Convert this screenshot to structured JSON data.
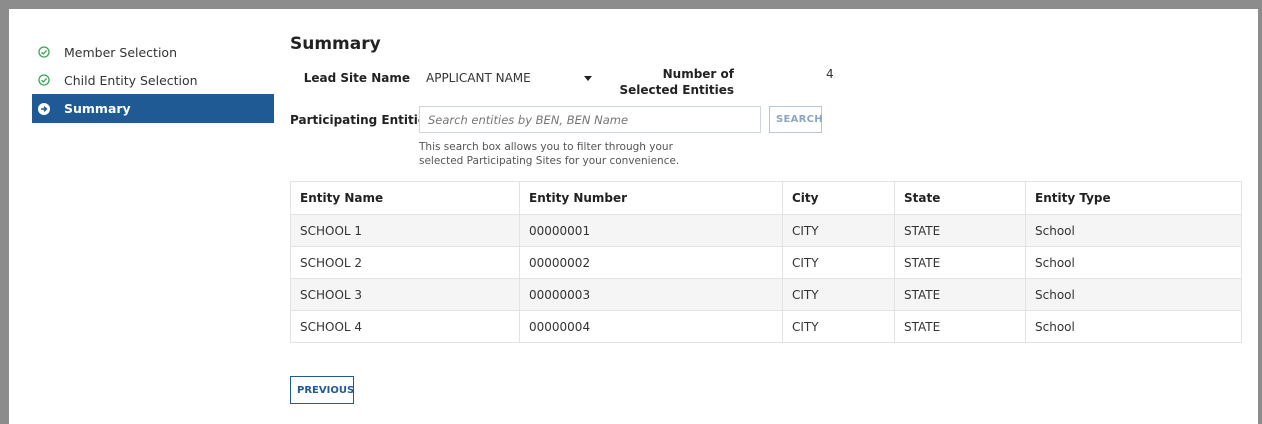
{
  "sidebar": {
    "steps": [
      {
        "label": "Member Selection",
        "icon": "check-circle-icon",
        "state": "complete"
      },
      {
        "label": "Child Entity Selection",
        "icon": "check-circle-icon",
        "state": "complete"
      },
      {
        "label": "Summary",
        "icon": "arrow-circle-right-icon",
        "state": "active"
      }
    ]
  },
  "summary": {
    "title": "Summary",
    "lead_site_label": "Lead Site Name",
    "lead_site_value": "APPLICANT NAME",
    "selected_count_label": "Number of Selected Entities",
    "selected_count_value": "4",
    "participating_label": "Participating Entities",
    "search_placeholder": "Search entities by BEN, BEN Name",
    "search_button": "SEARCH",
    "help_text": "This search box allows you to filter through your selected Participating Sites for your convenience."
  },
  "table": {
    "columns": [
      "Entity Name",
      "Entity Number",
      "City",
      "State",
      "Entity Type"
    ],
    "rows": [
      [
        "SCHOOL 1",
        "00000001",
        "CITY",
        "STATE",
        "School"
      ],
      [
        "SCHOOL 2",
        "00000002",
        "CITY",
        "STATE",
        "School"
      ],
      [
        "SCHOOL 3",
        "00000003",
        "CITY",
        "STATE",
        "School"
      ],
      [
        "SCHOOL 4",
        "00000004",
        "CITY",
        "STATE",
        "School"
      ]
    ]
  },
  "footer": {
    "previous_label": "PREVIOUS"
  },
  "colors": {
    "accent": "#1f5a95",
    "complete_green": "#3aa655"
  }
}
